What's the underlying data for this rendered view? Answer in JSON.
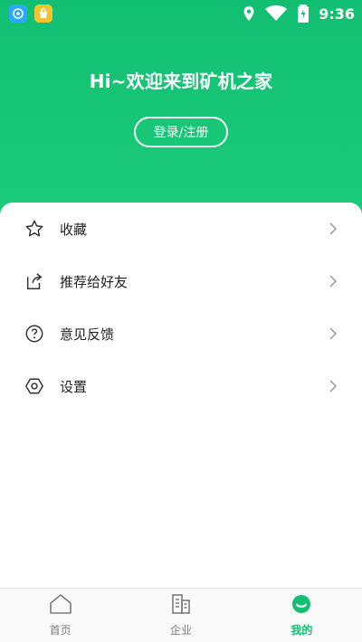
{
  "status_bar": {
    "time": "9:36",
    "icons": [
      "location-icon",
      "wifi-icon",
      "battery-charging-icon"
    ]
  },
  "hero": {
    "welcome_text": "Hi~欢迎来到矿机之家",
    "login_label": "登录/注册"
  },
  "menu": {
    "items": [
      {
        "label": "收藏",
        "icon": "star-icon"
      },
      {
        "label": "推荐给好友",
        "icon": "share-icon"
      },
      {
        "label": "意见反馈",
        "icon": "help-icon"
      },
      {
        "label": "设置",
        "icon": "settings-icon"
      }
    ]
  },
  "bottom_nav": {
    "items": [
      {
        "label": "首页",
        "icon": "home-icon"
      },
      {
        "label": "企业",
        "icon": "buildings-icon"
      },
      {
        "label": "我的",
        "icon": "profile-icon",
        "active": true
      }
    ]
  },
  "colors": {
    "accent": "#12bf72",
    "text_primary": "#222222",
    "text_secondary": "#7c7c7c",
    "background": "#ffffff"
  }
}
